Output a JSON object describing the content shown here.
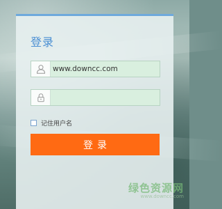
{
  "login": {
    "title": "登录",
    "username": {
      "value": "www.downcc.com",
      "icon": "user-icon"
    },
    "password": {
      "value": "",
      "icon": "lock-icon"
    },
    "remember_label": "记住用户名",
    "remember_checked": false,
    "submit_label": "登录"
  },
  "watermark": {
    "name": "绿色资源网",
    "url": "www.downcc.com"
  },
  "colors": {
    "accent": "#4b8fd3",
    "button": "#ff6a13",
    "input_bg": "#d9efdf",
    "top_bar": "#6ea9dc"
  }
}
